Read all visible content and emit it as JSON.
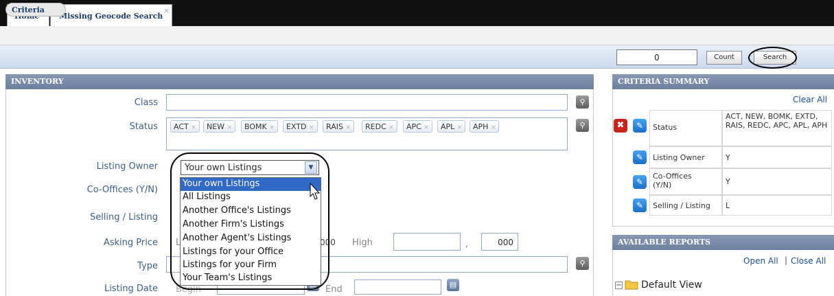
{
  "tabs": [
    {
      "label": "Home"
    },
    {
      "label": "Missing Geocode Search",
      "close": "×"
    }
  ],
  "subtoolbar": {
    "criteria_label": "Criteria"
  },
  "toolbar": {
    "count_value": "0",
    "count_label": "Count",
    "search_label": "Search"
  },
  "inventory": {
    "title": "INVENTORY",
    "class_label": "Class",
    "status_label": "Status",
    "status_chips": [
      "ACT",
      "NEW",
      "BOMK",
      "EXTD",
      "RAIS",
      "REDC",
      "APC",
      "APL",
      "APH"
    ],
    "chip_remove": "×",
    "listing_owner_label": "Listing Owner",
    "listing_owner_value": "Your own Listings",
    "listing_owner_options": [
      "Your own Listings",
      "All Listings",
      "Another Office's Listings",
      "Another Firm's Listings",
      "Another Agent's Listings",
      "Listings for your Office",
      "Listings for your Firm",
      "Your Team's Listings"
    ],
    "co_offices_label": "Co-Offices (Y/N)",
    "selling_listing_label": "Selling / Listing",
    "asking_price_label": "Asking Price",
    "asking_low_prefix": "L",
    "asking_low_suffix": "000",
    "high_label": "High",
    "comma": ",",
    "high_suffix": "000",
    "type_label": "Type",
    "listing_date_label": "Listing Date",
    "begin_label": "Begin",
    "end_label": "End"
  },
  "summary": {
    "title": "CRITERIA SUMMARY",
    "clear_all": "Clear All",
    "rows": [
      {
        "label": "Status",
        "value": "ACT, NEW, BOMK, EXTD, RAIS, REDC, APC, APL, APH"
      },
      {
        "label": "Listing Owner",
        "value": "Y"
      },
      {
        "label": "Co-Offices (Y/N)",
        "value": "Y"
      },
      {
        "label": "Selling / Listing",
        "value": "L"
      }
    ]
  },
  "reports": {
    "title": "AVAILABLE REPORTS",
    "open_all": "Open All",
    "separator": "|",
    "close_all": "Close All",
    "tree_item": "Default View"
  }
}
